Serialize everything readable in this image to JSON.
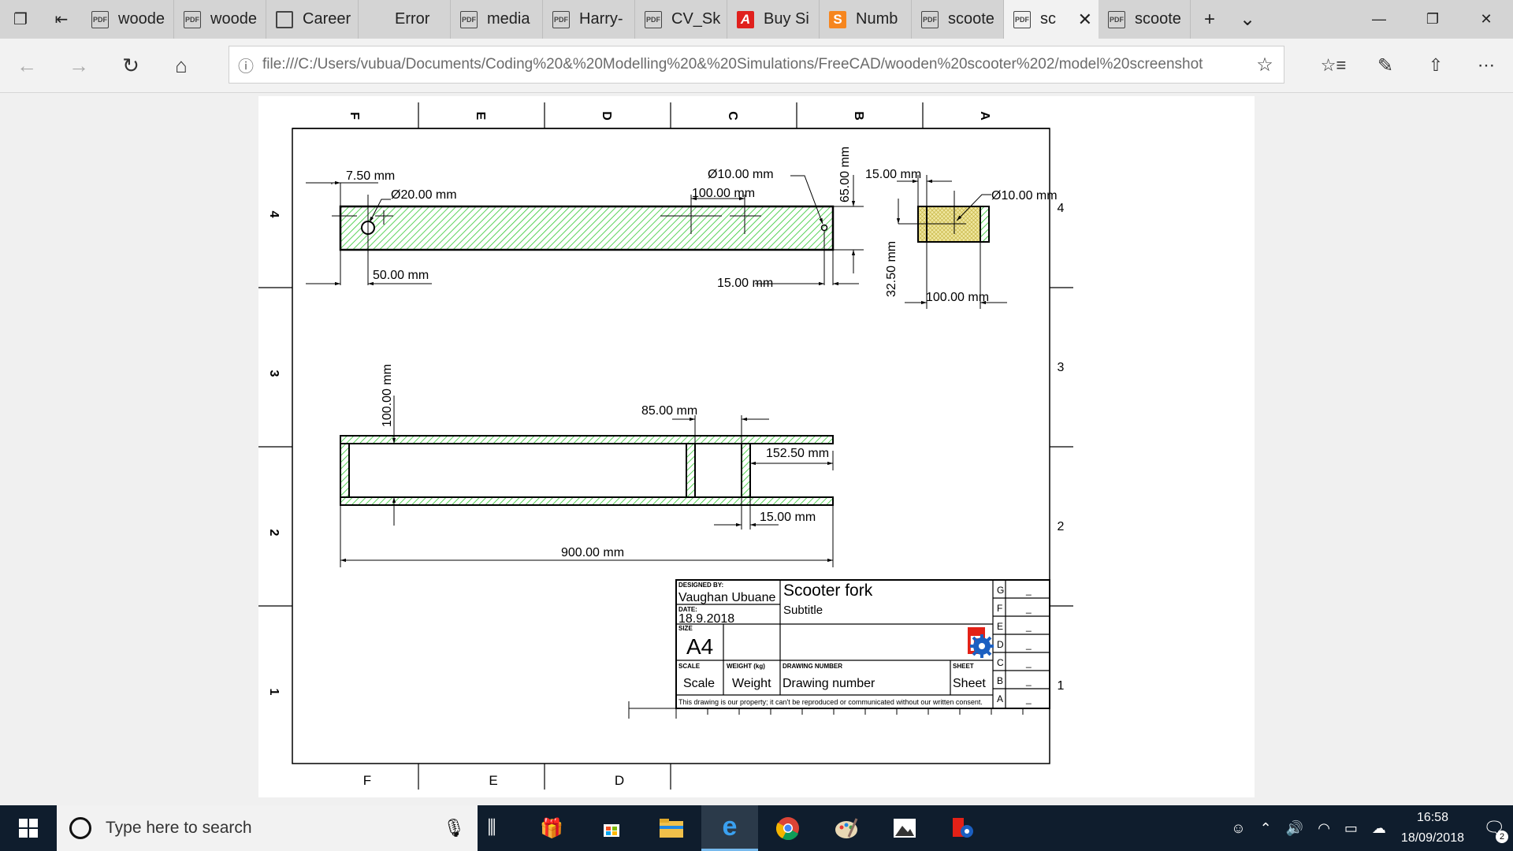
{
  "browser": {
    "tabs": [
      {
        "title": "woode",
        "icon": "pdf-icon"
      },
      {
        "title": "woode",
        "icon": "pdf-icon"
      },
      {
        "title": "Career",
        "icon": "page-icon"
      },
      {
        "title": "Error",
        "icon": "none"
      },
      {
        "title": "media",
        "icon": "pdf-icon"
      },
      {
        "title": "Harry-",
        "icon": "pdf-icon"
      },
      {
        "title": "CV_Sk",
        "icon": "pdf-icon"
      },
      {
        "title": "Buy Si",
        "icon": "adobe-icon"
      },
      {
        "title": "Numb",
        "icon": "smallpdf-icon"
      },
      {
        "title": "scoote",
        "icon": "pdf-icon"
      },
      {
        "title": "sc",
        "icon": "pdf-icon",
        "active": true
      },
      {
        "title": "scoote",
        "icon": "pdf-icon"
      }
    ],
    "pdf_badge": "PDF",
    "url": "file:///C:/Users/vubua/Documents/Coding%20&%20Modelling%20&%20Simulations/FreeCAD/wooden%20scooter%202/model%20screenshot"
  },
  "drawing": {
    "zone_letters": [
      "F",
      "E",
      "D",
      "C",
      "B",
      "A"
    ],
    "zone_numbers": [
      "4",
      "3",
      "2",
      "1"
    ],
    "bottom_letters": [
      "F",
      "E",
      "D"
    ],
    "dims": {
      "d1": "7.50  mm",
      "d2": "Ø20.00  mm",
      "d3": "50.00  mm",
      "d4": "Ø10.00  mm",
      "d5": "100.00  mm",
      "d6": "65.00  mm",
      "d7": "15.00  mm",
      "d8": "15.00  mm",
      "d9": "Ø10.00  mm",
      "d10": "32.50  mm",
      "d11": "100.00  mm",
      "d12": "100.00  mm",
      "d13": "85.00  mm",
      "d14": "152.50  mm",
      "d15": "15.00  mm",
      "d16": "900.00  mm"
    },
    "titleblock": {
      "designed_by_label": "DESIGNED BY:",
      "designer": "Vaughan Ubuane",
      "date_label": "DATE:",
      "date": "18.9.2018",
      "size_label": "SIZE",
      "size": "A4",
      "title": "Scooter fork",
      "subtitle": "Subtitle",
      "scale_label": "SCALE",
      "scale": "Scale",
      "weight_label": "WEIGHT (kg)",
      "weight": "Weight",
      "drawing_number_label": "DRAWING NUMBER",
      "drawing_number": "Drawing number",
      "sheet_label": "SHEET",
      "sheet": "Sheet",
      "notice": "This drawing is our property; it can't be reproduced or communicated without our written consent.",
      "revisions": [
        "G",
        "F",
        "E",
        "D",
        "C",
        "B",
        "A"
      ],
      "revision_mark": "_",
      "logo_letter": "F"
    }
  },
  "taskbar": {
    "search_placeholder": "Type here to search",
    "time": "16:58",
    "date": "18/09/2018",
    "notification_count": "2"
  },
  "colors": {
    "hatch_green": "#31c831",
    "section_fill": "#efe7a0",
    "accent_blue": "#0078d7"
  }
}
